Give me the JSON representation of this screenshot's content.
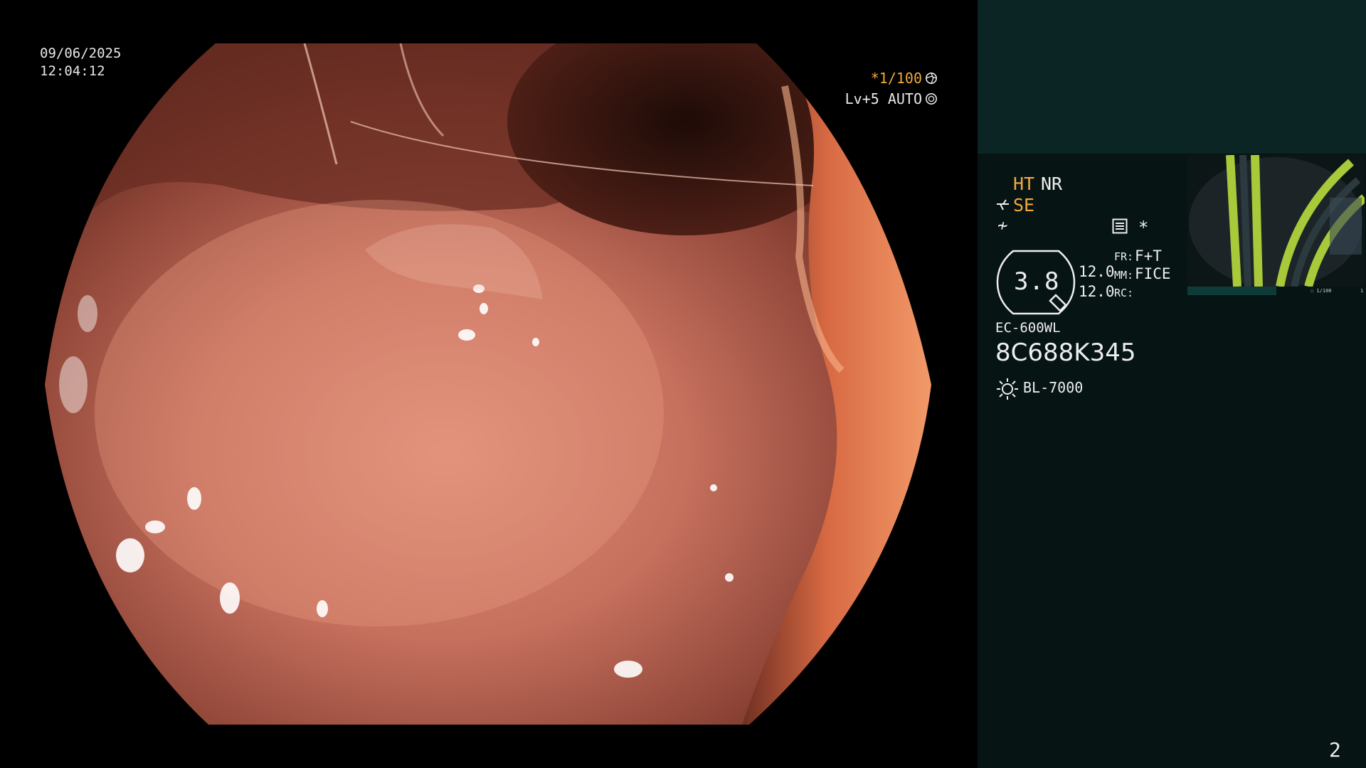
{
  "overlay": {
    "date": "09/06/2025",
    "time": "12:04:12",
    "shutter": "*1/100",
    "iris": "Lv+5 AUTO"
  },
  "panel": {
    "ht": "HT",
    "nr": "NR",
    "se": "SE",
    "noise_glyph": "≁",
    "star": "*",
    "zoom": "3.8",
    "value_1": "12.0",
    "value_2": "12.0",
    "fr_key": "FR:",
    "fr_value": "F+T",
    "mm_key": "MM:",
    "mm_value": "FICE",
    "rc_key": "RC:",
    "scope_model": "EC-600WL",
    "scope_serial": "8C688K345",
    "light_source": "BL-7000",
    "thumb_text": "◌ 1/100",
    "thumb_corner": "1"
  },
  "page_number": "2",
  "colors": {
    "accent": "#f2a93b",
    "panel_top": "#0b2424",
    "panel_bottom": "#071414",
    "mucosa": "#c56f5d"
  },
  "icons": {
    "shutter": "aperture-icon",
    "iris": "iris-icon",
    "structure": "scope-tip-icon",
    "menu": "menu-icon",
    "light": "sun-icon"
  }
}
